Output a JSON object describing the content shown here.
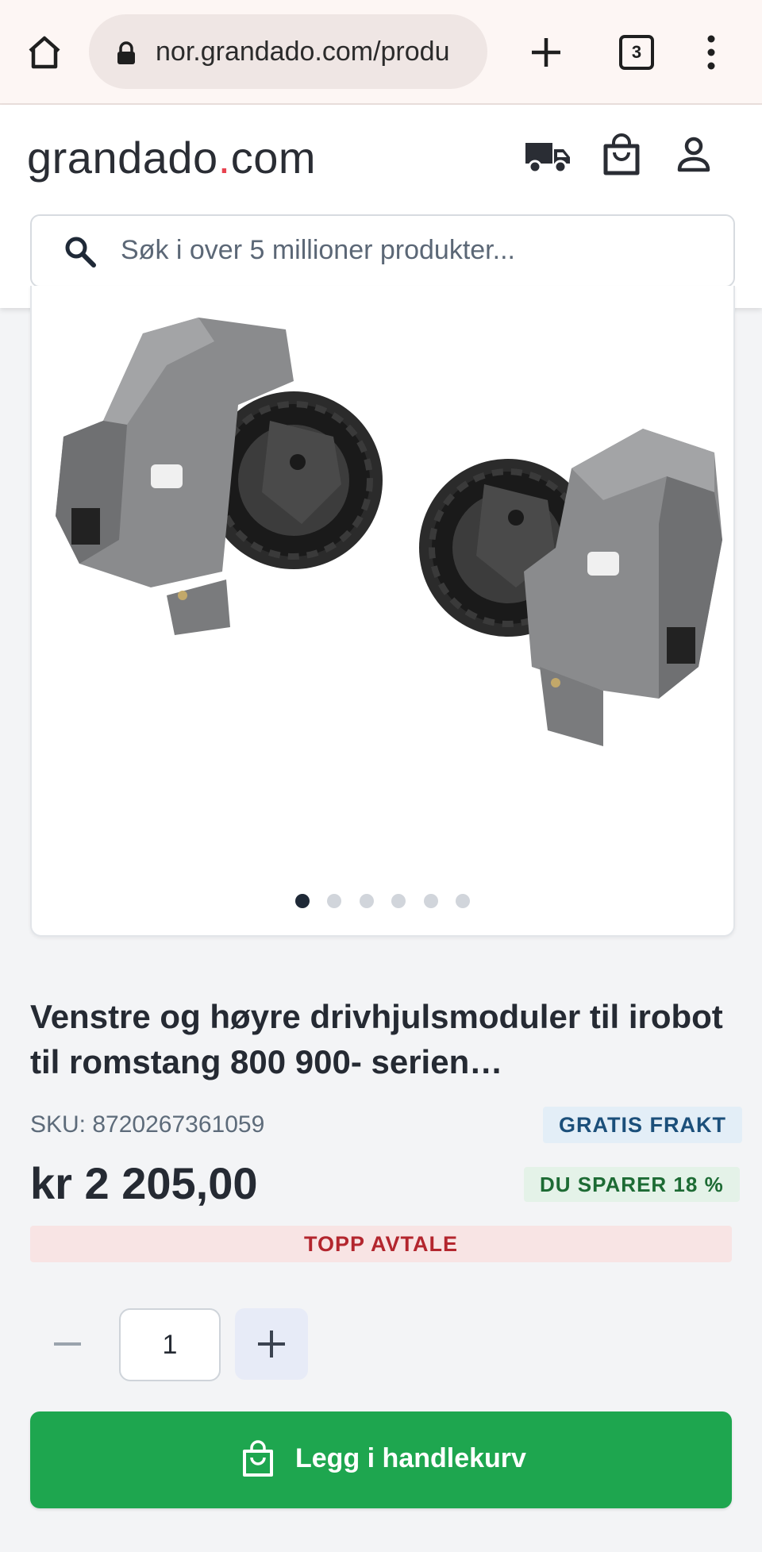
{
  "browser": {
    "url": "nor.grandado.com/produ",
    "tab_count": "3",
    "icons": [
      "home-icon",
      "lock-icon",
      "new-tab-icon",
      "tab-switcher-icon",
      "menu-kebab-icon"
    ]
  },
  "header": {
    "logo_part1": "grandado",
    "logo_dot": ".",
    "logo_part2": "com",
    "icons": [
      "truck-icon",
      "shopping-bag-icon",
      "user-icon"
    ],
    "search_placeholder": "Søk i over 5 millioner produkter..."
  },
  "gallery": {
    "image_count": 6,
    "active_index": 0
  },
  "product": {
    "title": "Venstre og høyre drivhjulsmoduler til irobot til romstang 800 900- serien…",
    "sku": "SKU: 8720267361059",
    "badge_shipping": "GRATIS FRAKT",
    "price": "kr 2 205,00",
    "badge_savings": "DU SPARER 18 %",
    "deal_label": "TOPP AVTALE",
    "quantity": "1",
    "add_to_cart_label": "Legg i handlekurv"
  },
  "colors": {
    "accent_green": "#1ea64f",
    "logo_dot": "#e8424f",
    "deal_red": "#b3262e",
    "shipping_blue": "#1b4f7a"
  }
}
